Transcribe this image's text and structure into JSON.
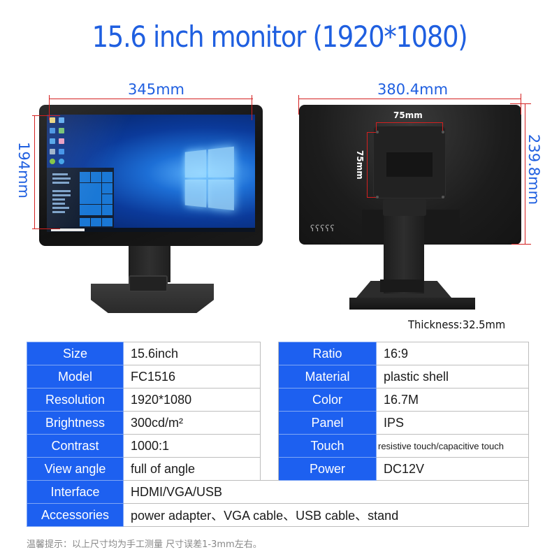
{
  "title": "15.6 inch monitor (1920*1080)",
  "dimensions": {
    "front_width": "345mm",
    "front_height": "194mm",
    "back_width": "380.4mm",
    "back_height": "239.8mm",
    "vesa_horizontal": "75mm",
    "vesa_vertical": "75mm",
    "thickness": "Thickness:32.5mm"
  },
  "keyhole_glyphs": "ʕʕʕʕʕ",
  "colors": {
    "accent_blue": "#1f5fe0",
    "table_key_bg": "#1d60f0",
    "measure_red": "#d42020"
  },
  "specs_left": [
    {
      "key": "Size",
      "value": "15.6inch"
    },
    {
      "key": "Model",
      "value": "FC1516"
    },
    {
      "key": "Resolution",
      "value": "1920*1080"
    },
    {
      "key": "Brightness",
      "value": "300cd/m²"
    },
    {
      "key": "Contrast",
      "value": "1000:1"
    },
    {
      "key": "View angle",
      "value": "full of angle"
    }
  ],
  "specs_right": [
    {
      "key": "Ratio",
      "value": "16:9"
    },
    {
      "key": "Material",
      "value": "plastic shell"
    },
    {
      "key": "Color",
      "value": "16.7M"
    },
    {
      "key": "Panel",
      "value": "IPS"
    },
    {
      "key": "Touch",
      "value": "resistive touch/capacitive touch"
    },
    {
      "key": "Power",
      "value": "DC12V"
    }
  ],
  "specs_full": [
    {
      "key": "Interface",
      "value": "HDMI/VGA/USB"
    },
    {
      "key": "Accessories",
      "value": "power adapter、VGA cable、USB cable、stand"
    }
  ],
  "note": "温馨提示：以上尺寸均为手工测量   尺寸误差1-3mm左右。"
}
